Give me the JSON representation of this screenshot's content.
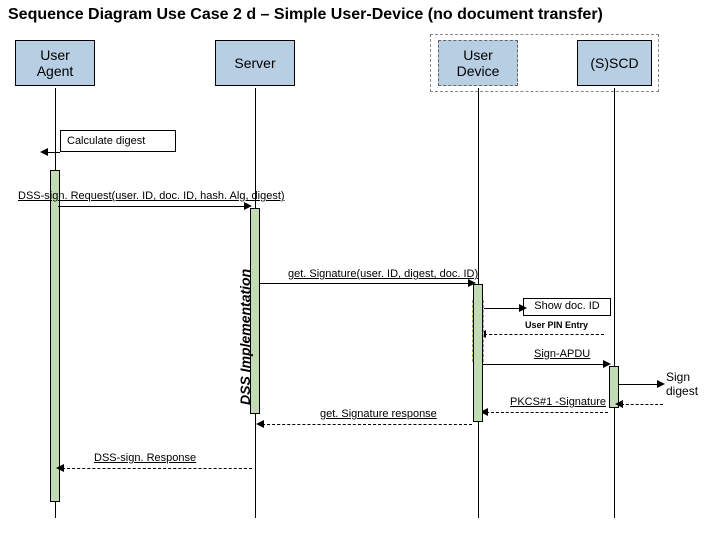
{
  "title": "Sequence Diagram Use Case 2 d – Simple User-Device (no document transfer)",
  "actors": {
    "userAgent": "User\nAgent",
    "server": "Server",
    "userDevice": "User\nDevice",
    "sscd": "(S)SCD"
  },
  "messages": {
    "calcDigest": "Calculate digest",
    "dssSignRequest": "DSS-sign. Request(user. ID, doc. ID, hash. Alg, digest)",
    "getSignature": "get. Signature(user. ID, digest, doc. ID)",
    "showDocId": "Show doc. ID",
    "userPinEntry": "User PIN Entry",
    "signApdu": "Sign-APDU",
    "pkcsSig": "PKCS#1 -Signature",
    "getSigResponse": "get. Signature response",
    "dssSignResponse": "DSS-sign. Response"
  },
  "labels": {
    "dssImpl": "DSS Implementation",
    "signDigest": "Sign\ndigest"
  }
}
